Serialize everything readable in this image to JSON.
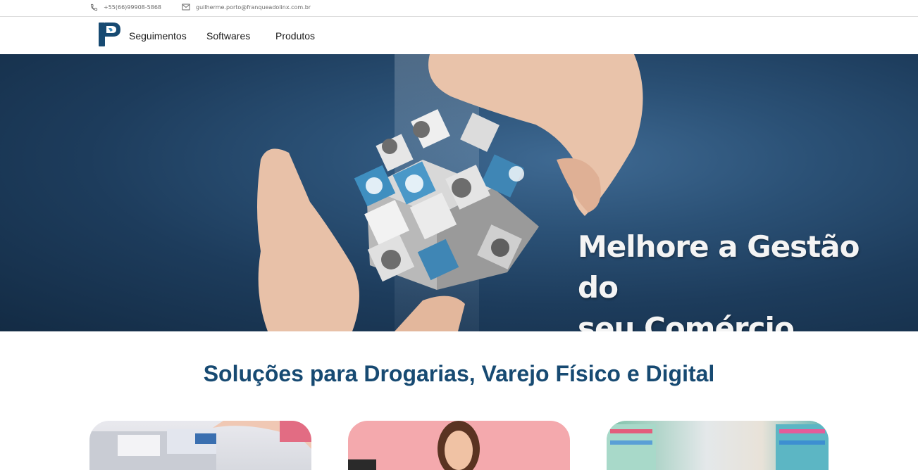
{
  "topbar": {
    "phone": "+55(66)99908-5868",
    "email": "guilherme.porto@franqueadolinx.com.br",
    "icons": [
      "phone-icon",
      "mail-icon"
    ]
  },
  "nav": {
    "logo": "P",
    "items": [
      "Seguimentos",
      "Softwares",
      "Produtos"
    ]
  },
  "hero": {
    "heading_line1": "Melhore a Gestão do",
    "heading_line2": "seu Comércio"
  },
  "section": {
    "title": "Soluções para Drogarias, Varejo Físico e Digital"
  },
  "cards": [
    {
      "name": "pharmacy-card"
    },
    {
      "name": "woman-card"
    },
    {
      "name": "supermarket-card"
    }
  ],
  "colors": {
    "brand": "#174a72",
    "hero_bg": "#1d3c5c",
    "accent_blue": "#3f8fc0"
  }
}
